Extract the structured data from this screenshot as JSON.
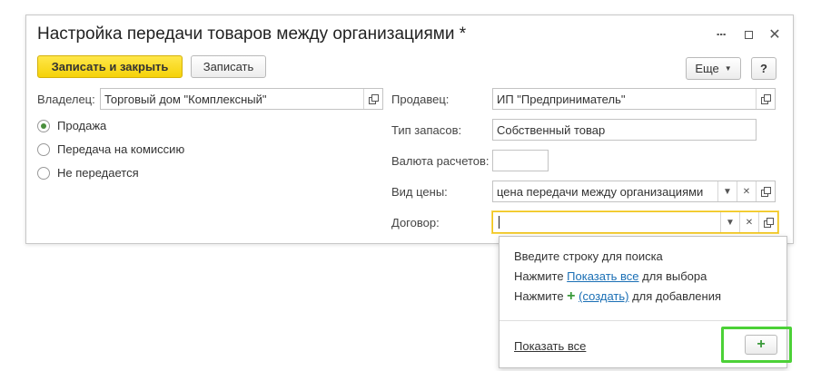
{
  "window": {
    "title": "Настройка передачи товаров между организациями *"
  },
  "toolbar": {
    "save_close_label": "Записать и закрыть",
    "save_label": "Записать",
    "more_label": "Еще",
    "help_label": "?"
  },
  "owner": {
    "label": "Владелец:",
    "value": "Торговый дом \"Комплексный\""
  },
  "transfer_mode": {
    "options": [
      {
        "label": "Продажа",
        "selected": true
      },
      {
        "label": "Передача на комиссию",
        "selected": false
      },
      {
        "label": "Не передается",
        "selected": false
      }
    ]
  },
  "seller": {
    "label": "Продавец:",
    "value": "ИП \"Предприниматель\""
  },
  "stock_type": {
    "label": "Тип запасов:",
    "value": "Собственный товар"
  },
  "currency": {
    "label": "Валюта расчетов:",
    "value": ""
  },
  "price_type": {
    "label": "Вид цены:",
    "value": "цена передачи между организациями"
  },
  "contract": {
    "label": "Договор:",
    "value": ""
  },
  "popup": {
    "hint_line1": "Введите строку для поиска",
    "hint2_prefix": "Нажмите ",
    "hint2_link": "Показать все",
    "hint2_suffix": " для выбора",
    "hint3_prefix": "Нажмите ",
    "hint3_link": "(создать)",
    "hint3_suffix": " для добавления",
    "show_all_link": "Показать все"
  },
  "colors": {
    "accent_yellow": "#f5d209",
    "link_blue": "#1a6fb5",
    "highlight_green": "#4cd137"
  },
  "icons": {
    "plus": "plus-icon",
    "open": "open-icon",
    "clear": "clear-icon",
    "dropdown": "chevron-down-icon"
  }
}
